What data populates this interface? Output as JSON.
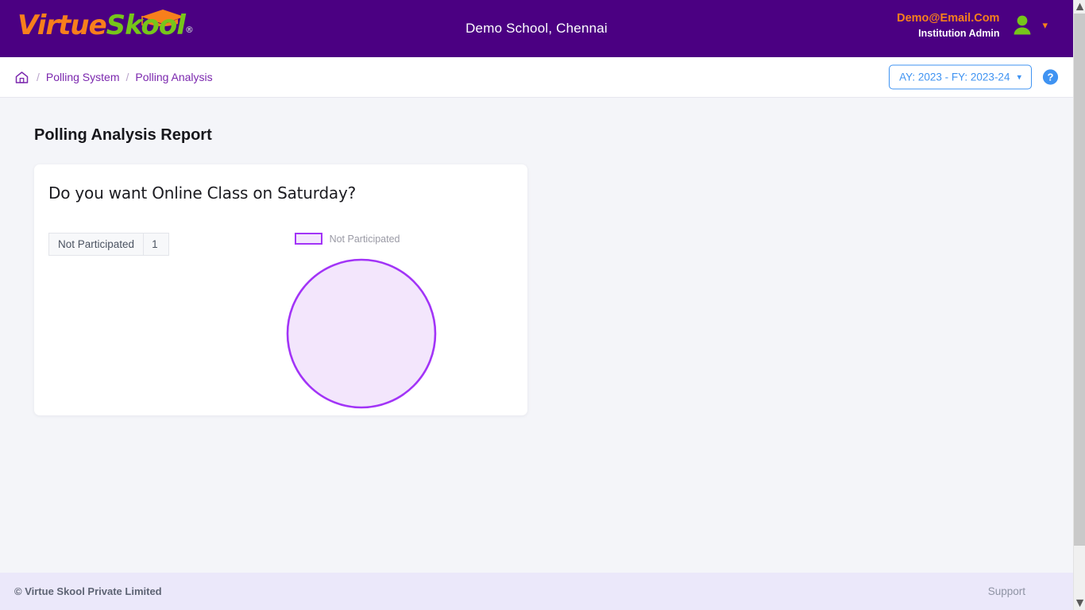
{
  "header": {
    "logo": {
      "part1": "Virtue",
      "part2": "Skool",
      "registered": "®",
      "cap_icon": "graduation-cap-icon"
    },
    "school_title": "Demo School, Chennai",
    "user": {
      "email": "Demo@Email.Com",
      "role": "Institution Admin",
      "avatar_icon": "user-avatar-icon",
      "caret_icon": "chevron-down-icon"
    }
  },
  "breadcrumb": {
    "home_icon": "home-icon",
    "separator": "/",
    "items": [
      {
        "label": "Polling System"
      },
      {
        "label": "Polling Analysis"
      }
    ],
    "academic_year_selector": {
      "value": "AY: 2023 - FY: 2023-24",
      "chevron": "⌄",
      "chevron_icon": "chevron-down-icon"
    },
    "help_icon": "help-circle-icon",
    "help_glyph": "?"
  },
  "main": {
    "page_title": "Polling Analysis Report",
    "card": {
      "question": "Do you want Online Class on Saturday?"
    }
  },
  "chart_data": {
    "type": "pie",
    "title": "Do you want Online Class on Saturday?",
    "categories": [
      "Not Participated"
    ],
    "values": [
      1
    ],
    "percentages": [
      100
    ],
    "colors": [
      "#f3e6fc"
    ],
    "stroke_colors": [
      "#a234f7"
    ],
    "legend": [
      "Not Participated"
    ],
    "legend_position": "top",
    "table": {
      "rows": [
        {
          "label": "Not Participated",
          "value": "1"
        }
      ]
    }
  },
  "footer": {
    "copyright": "© Virtue Skool Private Limited",
    "support": "Support"
  },
  "scrollbar": {
    "up_arrow": "⌃",
    "down_arrow": "⌄"
  }
}
